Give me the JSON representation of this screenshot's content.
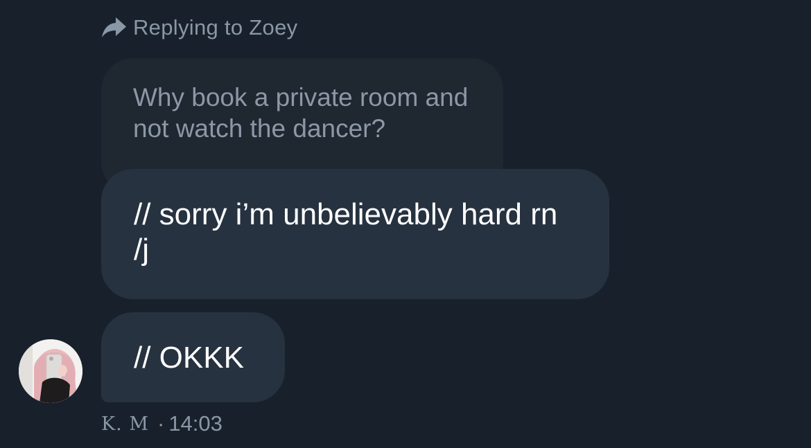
{
  "reply_context": {
    "label": "Replying to Zoey",
    "icon": "reply-arrow-icon"
  },
  "quoted_message": {
    "text": "Why book a private room and not watch the dancer?"
  },
  "messages": [
    {
      "text": "// sorry i’m unbelievably hard rn /j"
    },
    {
      "text": "// OKKK"
    }
  ],
  "sender": {
    "name": "K. M",
    "separator": "·",
    "time": "14:03",
    "avatar": "user-avatar"
  },
  "colors": {
    "background": "#18212b",
    "quoted_bubble": "#1f2731",
    "message_bubble": "#273240",
    "secondary_text": "#8a97a6",
    "primary_text": "#ffffff"
  }
}
